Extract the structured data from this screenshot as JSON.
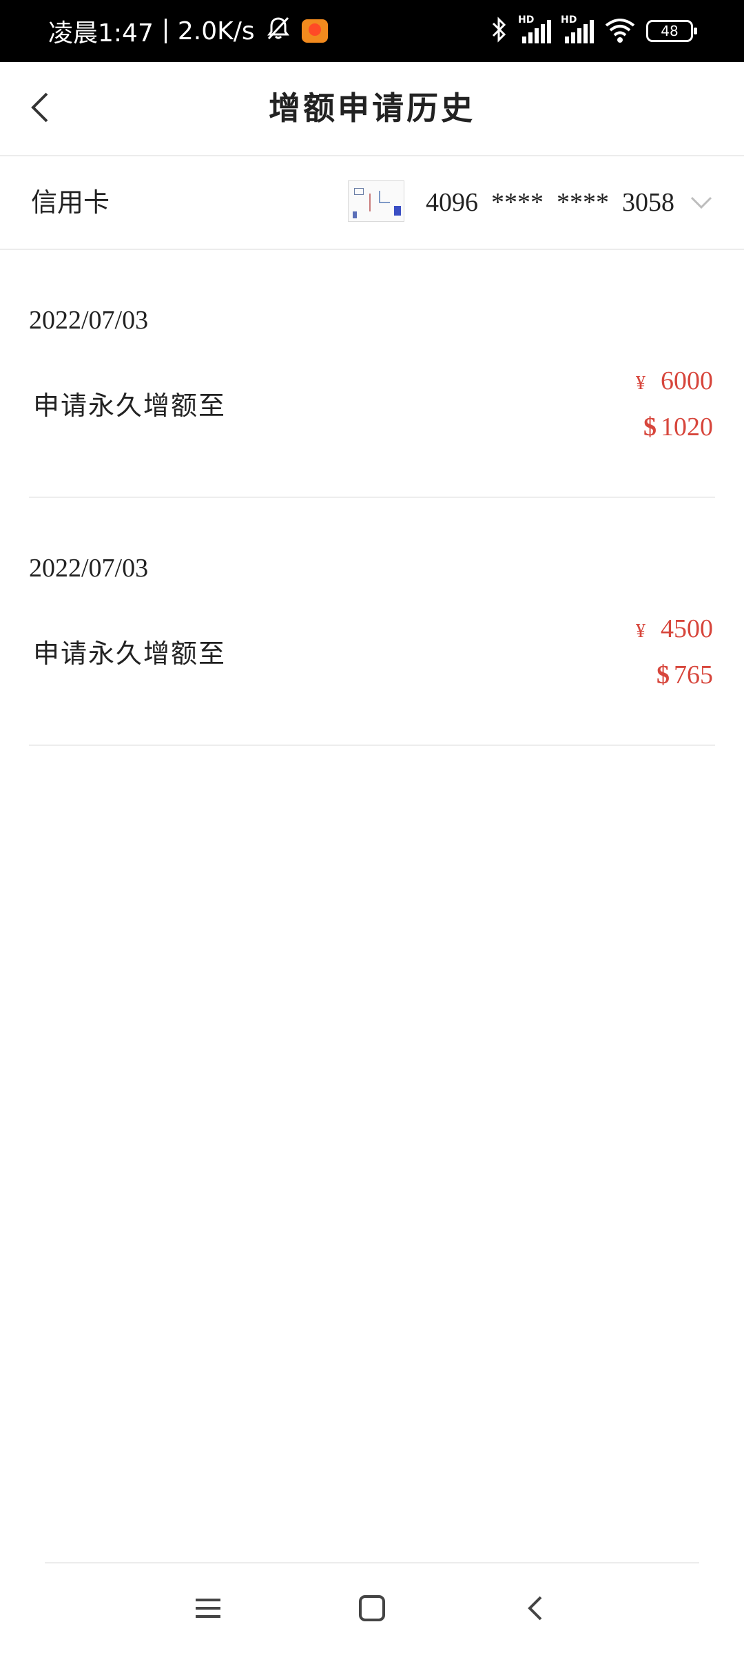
{
  "status_bar": {
    "time": "凌晨1:47",
    "net_speed": "2.0K/s",
    "signal_hd_1": "HD",
    "signal_hd_2": "HD",
    "battery": "48"
  },
  "header": {
    "title": "增额申请历史"
  },
  "card_selector": {
    "label": "信用卡",
    "card_number": "4096  ****  ****  3058"
  },
  "records": [
    {
      "date": "2022/07/03",
      "description": "申请永久增额至",
      "cny_symbol": "¥",
      "cny_amount": "6000",
      "usd_symbol": "$",
      "usd_amount": "1020"
    },
    {
      "date": "2022/07/03",
      "description": "申请永久增额至",
      "cny_symbol": "¥",
      "cny_amount": "4500",
      "usd_symbol": "$",
      "usd_amount": "765"
    }
  ],
  "colors": {
    "accent": "#d7463c",
    "status_bar_bg": "#000000",
    "divider": "#ececec"
  },
  "icons": {
    "status": [
      "bell-off-icon",
      "app-notification-icon",
      "bluetooth-icon",
      "signal-icon",
      "wifi-icon",
      "battery-icon"
    ],
    "header": [
      "back-arrow-icon"
    ],
    "card": [
      "card-thumbnail",
      "chevron-down-icon"
    ],
    "nav": [
      "menu-icon",
      "home-icon",
      "back-icon"
    ]
  }
}
